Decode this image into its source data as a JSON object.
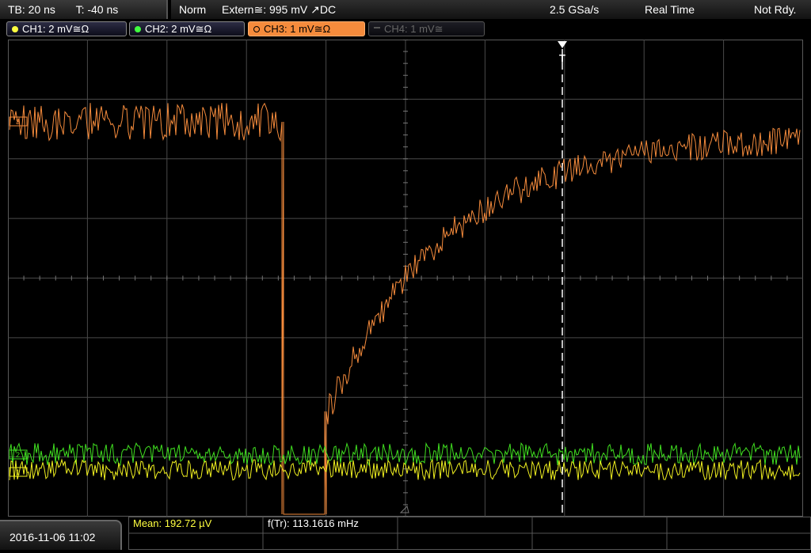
{
  "header": {
    "timebase": "TB: 20 ns",
    "trigger_offset": "T: -40 ns",
    "trigger_mode": "Norm",
    "trigger_source": "Extern≅: 995 mV ↗DC",
    "sample_rate": "2.5 GSa/s",
    "acq_mode": "Real Time",
    "status": "Not Rdy."
  },
  "channels": [
    {
      "label": "CH1: 2 mV≅Ω",
      "color": "#ffff40",
      "state": "on"
    },
    {
      "label": "CH2: 2 mV≅Ω",
      "color": "#40ff40",
      "state": "on"
    },
    {
      "label": "CH3: 1 mV≅Ω",
      "color": "#f58b3c",
      "state": "active"
    },
    {
      "label": "CH4: 1 mV≅",
      "color": "#888888",
      "state": "off"
    }
  ],
  "screen": {
    "trigger_marker": "T",
    "ch3_marker": "3",
    "ch2_marker": "2",
    "ch1_marker": "1",
    "grid_color": "#4a4a4a",
    "ch3_color": "#f58b3c",
    "ch2_color": "#40e020",
    "ch1_color": "#f0f020"
  },
  "footer": {
    "datetime": "2016-11-06 11:02",
    "measurements": [
      {
        "label": "Mean: 192.72 µV",
        "color": "#ffff40"
      },
      {
        "label": "f(Tr): 113.1616 mHz",
        "color": "#ffffff"
      }
    ]
  }
}
